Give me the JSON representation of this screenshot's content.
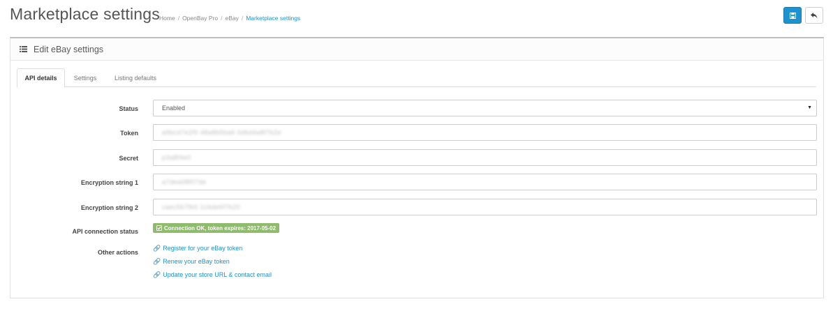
{
  "header": {
    "title": "Marketplace settings",
    "breadcrumb": [
      "Home",
      "OpenBay Pro",
      "eBay",
      "Marketplace settings"
    ]
  },
  "toolbar": {
    "save_icon": "save-icon",
    "back_icon": "reply-icon"
  },
  "panel": {
    "title": "Edit eBay settings",
    "title_icon": "list-icon"
  },
  "tabs": [
    {
      "label": "API details",
      "active": true
    },
    {
      "label": "Settings",
      "active": false
    },
    {
      "label": "Listing defaults",
      "active": false
    }
  ],
  "form": {
    "status": {
      "label": "Status",
      "value": "Enabled"
    },
    "token": {
      "label": "Token",
      "value": "a9bcd7e2f0 48a8b5ba6 0d6d4a8f7b2e"
    },
    "secret": {
      "label": "Secret",
      "value": "p3a8f4e0"
    },
    "encryption_string_1": {
      "label": "Encryption string 1",
      "value": "a7dea08f07de"
    },
    "encryption_string_2": {
      "label": "Encryption string 2",
      "value": "caec5b7fb0 1c6de6f7b20"
    },
    "api_status": {
      "label": "API connection status",
      "value": "Connection OK, token expires: 2017-05-02"
    },
    "other_actions": {
      "label": "Other actions",
      "links": [
        "Register for your eBay token",
        "Renew your eBay token",
        "Update your store URL & contact email"
      ]
    }
  },
  "colors": {
    "primary": "#1e91cf",
    "success": "#8fbb6c"
  }
}
